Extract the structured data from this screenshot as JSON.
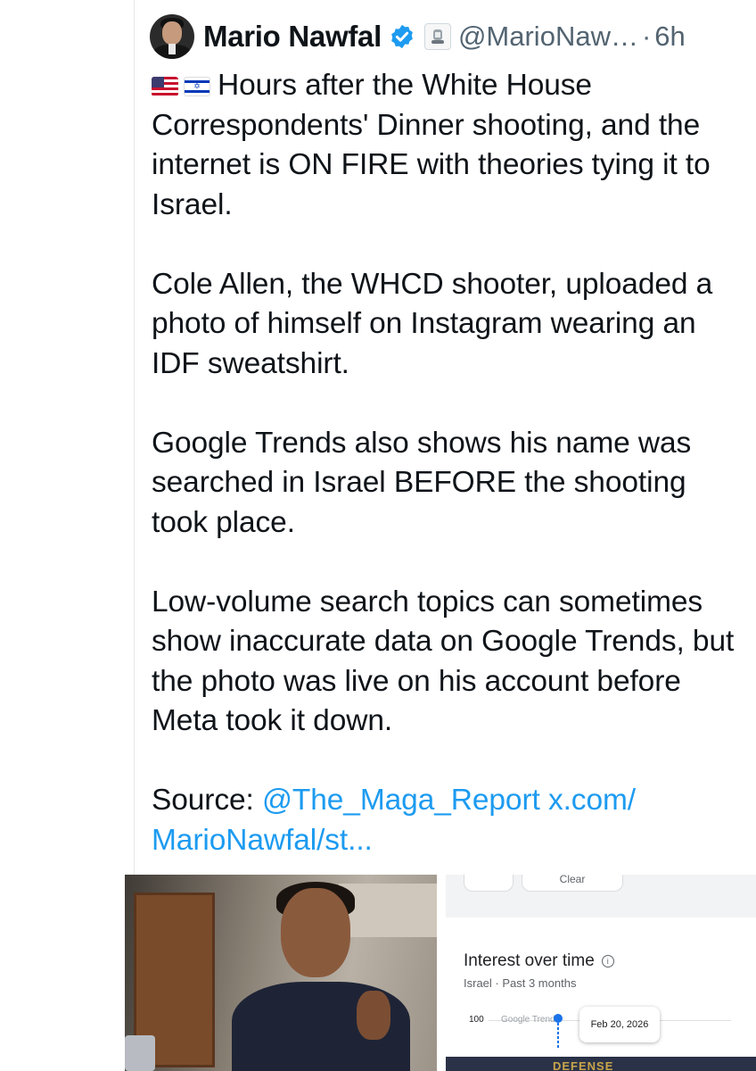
{
  "post": {
    "author_name": "Mario Nawfal",
    "handle": "@MarioNaw…",
    "separator": "·",
    "time": "6h",
    "flags_alt": "🇺🇸🇮🇱",
    "paragraph_1": "Hours after the White House Correspondents' Dinner shooting, and the internet is ON FIRE with theories tying it to Israel.",
    "paragraph_2": "Cole Allen, the WHCD shooter, uploaded a photo of himself on Instagram wearing an IDF sweatshirt.",
    "paragraph_3": "Google Trends also shows his name was searched in Israel BEFORE the shooting took place.",
    "paragraph_4": "Low-volume search topics can sometimes show inaccurate data on Google Trends, but the photo was live on his account before Meta took it down.",
    "source_label": "Source: ",
    "source_mention": "@The_Maga_Report",
    "source_link": "x.com/ MarioNawfal/st..."
  },
  "media": {
    "trends": {
      "clear_label": "Clear",
      "title": "Interest over time",
      "subtitle": "Israel · Past 3 months",
      "axis_label": "100",
      "mini_label": "Google Trends",
      "tooltip_date": "Feb 20, 2026",
      "shirt_text": "DEFENSE"
    }
  },
  "colors": {
    "link": "#1d9bf0",
    "verified": "#1d9bf0",
    "secondary_text": "#536471"
  },
  "icons": [
    "verified-badge-icon",
    "affiliate-badge-icon",
    "info-icon"
  ]
}
